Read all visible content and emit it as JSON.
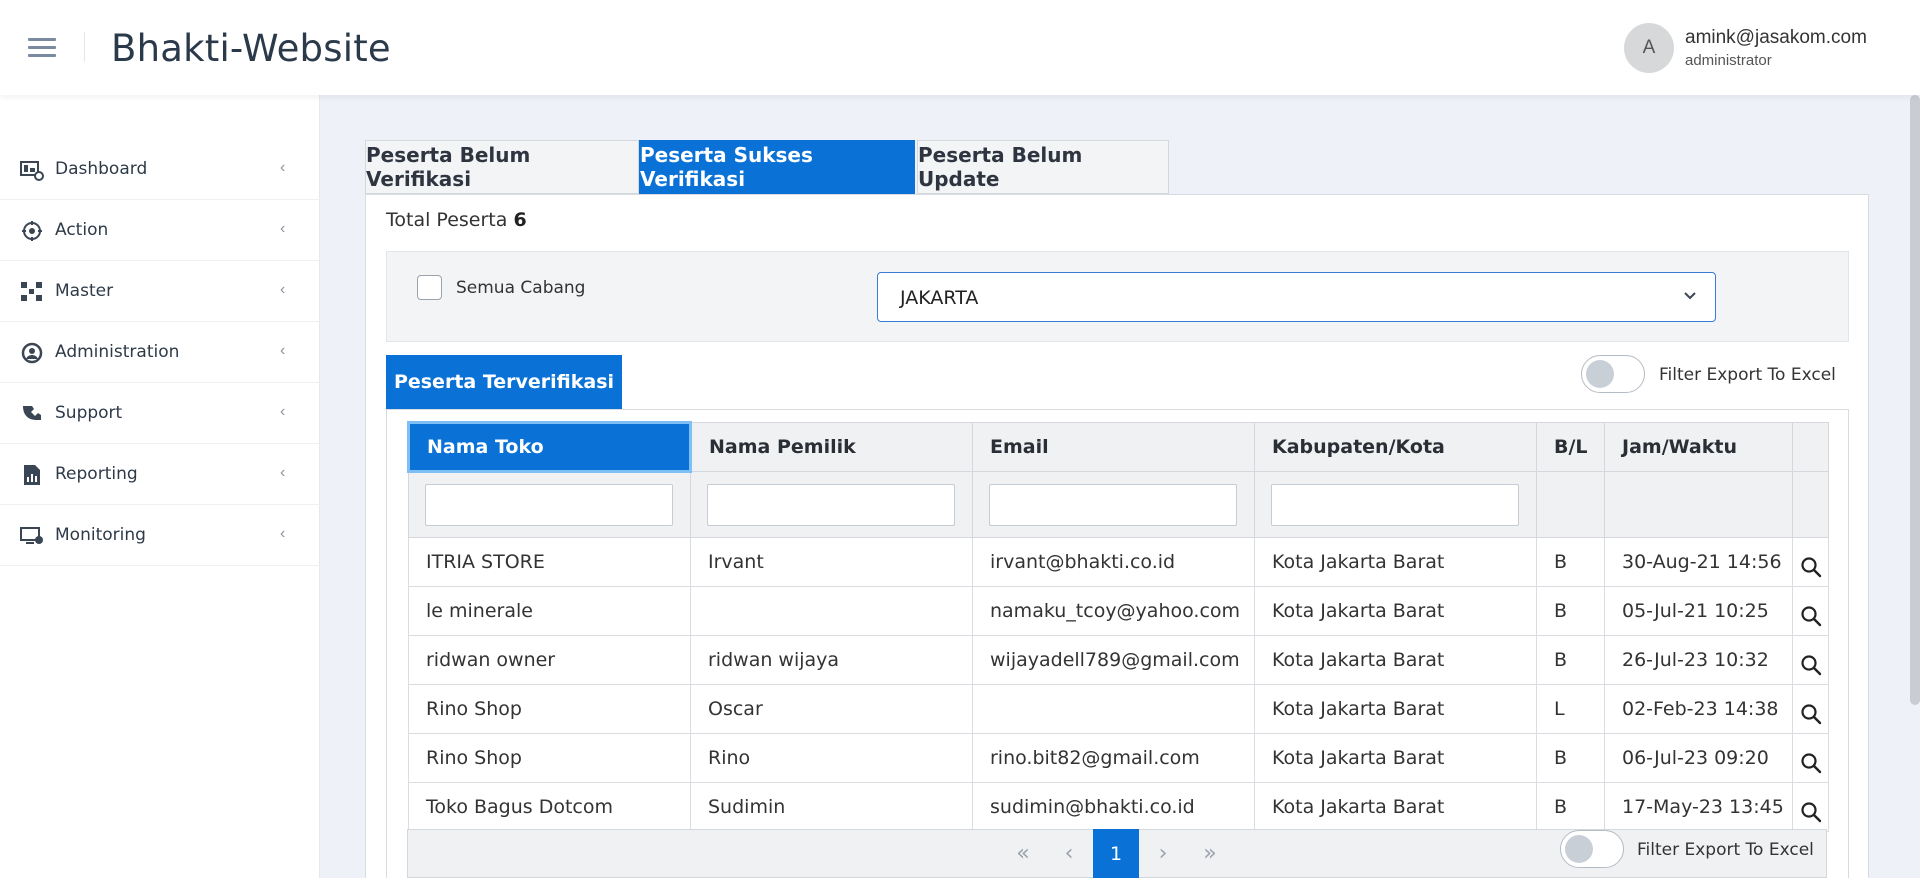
{
  "header": {
    "title": "Bhakti-Website",
    "avatar_letter": "A",
    "user_email": "amink@jasakom.com",
    "user_role": "administrator"
  },
  "sidebar": {
    "items": [
      {
        "label": "Dashboard",
        "icon": "dashboard-icon"
      },
      {
        "label": "Action",
        "icon": "action-icon"
      },
      {
        "label": "Master",
        "icon": "master-icon"
      },
      {
        "label": "Administration",
        "icon": "administration-icon"
      },
      {
        "label": "Support",
        "icon": "support-icon"
      },
      {
        "label": "Reporting",
        "icon": "reporting-icon"
      },
      {
        "label": "Monitoring",
        "icon": "monitoring-icon"
      }
    ]
  },
  "tabs": [
    {
      "label": "Peserta Belum Verifikasi",
      "active": false
    },
    {
      "label": "Peserta Sukses Verifikasi",
      "active": true
    },
    {
      "label": "Peserta Belum Update",
      "active": false
    }
  ],
  "summary": {
    "label": "Total Peserta",
    "count": "6"
  },
  "filters": {
    "checkbox_label": "Semua Cabang",
    "checked": false,
    "branch_selected": "JAKARTA"
  },
  "subtab": {
    "label": "Peserta Terverifikasi"
  },
  "export_toggle": {
    "label": "Filter Export To Excel",
    "on": false
  },
  "table": {
    "columns": [
      "Nama Toko",
      "Nama Pemilik",
      "Email",
      "Kabupaten/Kota",
      "B/L",
      "Jam/Waktu"
    ],
    "rows": [
      [
        "ITRIA STORE",
        "Irvant",
        "irvant@bhakti.co.id",
        "Kota Jakarta Barat",
        "B",
        "30-Aug-21 14:56"
      ],
      [
        "le minerale",
        "",
        "namaku_tcoy@yahoo.com",
        "Kota Jakarta Barat",
        "B",
        "05-Jul-21 10:25"
      ],
      [
        "ridwan owner",
        "ridwan wijaya",
        "wijayadell789@gmail.com",
        "Kota Jakarta Barat",
        "B",
        "26-Jul-23 10:32"
      ],
      [
        "Rino Shop",
        "Oscar",
        "",
        "Kota Jakarta Barat",
        "L",
        "02-Feb-23 14:38"
      ],
      [
        "Rino Shop",
        "Rino",
        "rino.bit82@gmail.com",
        "Kota Jakarta Barat",
        "B",
        "06-Jul-23 09:20"
      ],
      [
        "Toko Bagus Dotcom",
        "Sudimin",
        "sudimin@bhakti.co.id",
        "Kota Jakarta Barat",
        "B",
        "17-May-23 13:45"
      ]
    ]
  },
  "pagination": {
    "first": "«",
    "prev": "‹",
    "current": "1",
    "next": "›",
    "last": "»"
  },
  "colors": {
    "primary": "#0a72d6",
    "background": "#eef1f8"
  }
}
